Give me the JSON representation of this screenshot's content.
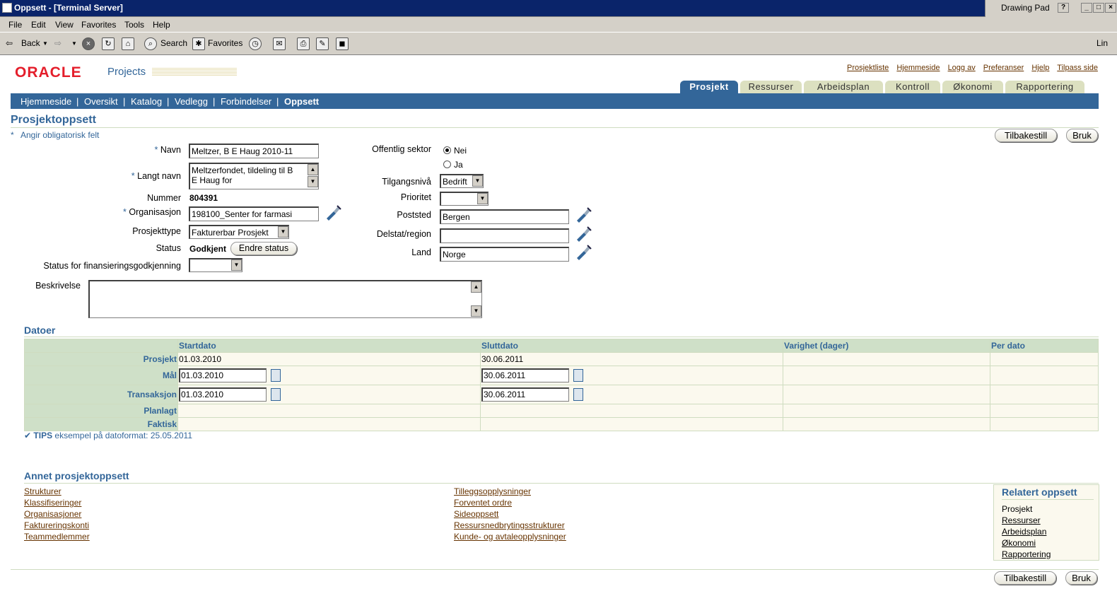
{
  "window": {
    "title": "Oppsett - [Terminal Server]",
    "drawing_pad": "Drawing Pad"
  },
  "menu": [
    "File",
    "Edit",
    "View",
    "Favorites",
    "Tools",
    "Help"
  ],
  "toolbar": {
    "back": "Back",
    "search": "Search",
    "favorites": "Favorites",
    "links": "Lin"
  },
  "brand": {
    "logo": "ORACLE",
    "product": "Projects"
  },
  "global_links": [
    "Prosjektliste",
    "Hjemmeside",
    "Logg av",
    "Preferanser",
    "Hjelp",
    "Tilpass side"
  ],
  "tabs": [
    "Prosjekt",
    "Ressurser",
    "Arbeidsplan",
    "Kontroll",
    "Økonomi",
    "Rapportering"
  ],
  "subnav": [
    "Hjemmeside",
    "Oversikt",
    "Katalog",
    "Vedlegg",
    "Forbindelser",
    "Oppsett"
  ],
  "page": {
    "title": "Prosjektoppsett",
    "required_note": "Angir obligatorisk felt"
  },
  "buttons": {
    "reset": "Tilbakestill",
    "apply": "Bruk",
    "change_status": "Endre status"
  },
  "form": {
    "navn_label": "Navn",
    "navn": "Meltzer, B E Haug 2010-11",
    "langt_navn_label": "Langt navn",
    "langt_navn_line1": "Meltzerfondet, tildeling til B",
    "langt_navn_line2": "E Haug for",
    "nummer_label": "Nummer",
    "nummer": "804391",
    "org_label": "Organisasjon",
    "org": "198100_Senter for farmasi",
    "type_label": "Prosjekttype",
    "type": "Fakturerbar Prosjekt",
    "status_label": "Status",
    "status": "Godkjent",
    "fin_label": "Status for finansieringsgodkjenning",
    "fin": "",
    "beskrivelse_label": "Beskrivelse",
    "beskrivelse": "",
    "offentlig_label": "Offentlig sektor",
    "nei": "Nei",
    "ja": "Ja",
    "tilgang_label": "Tilgangsnivå",
    "tilgang": "Bedrift",
    "prioritet_label": "Prioritet",
    "prioritet": "",
    "poststed_label": "Poststed",
    "poststed": "Bergen",
    "delstat_label": "Delstat/region",
    "delstat": "",
    "land_label": "Land",
    "land": "Norge"
  },
  "dates": {
    "title": "Datoer",
    "headers": [
      "Startdato",
      "Sluttdato",
      "Varighet (dager)",
      "Per dato"
    ],
    "rows": [
      {
        "label": "Prosjekt",
        "start": "01.03.2010",
        "end": "30.06.2011"
      },
      {
        "label": "Mål",
        "start": "01.03.2010",
        "end": "30.06.2011"
      },
      {
        "label": "Transaksjon",
        "start": "01.03.2010",
        "end": "30.06.2011"
      },
      {
        "label": "Planlagt",
        "start": "",
        "end": ""
      },
      {
        "label": "Faktisk",
        "start": "",
        "end": ""
      }
    ],
    "tip_label": "TIPS",
    "tip": "eksempel på datoformat: 25.05.2011"
  },
  "other": {
    "title": "Annet prosjektoppsett",
    "col1": [
      "Strukturer",
      "Klassifiseringer",
      "Organisasjoner",
      "Faktureringskonti",
      "Teammedlemmer"
    ],
    "col2": [
      "Tilleggsopplysninger",
      "Forventet ordre",
      "Sideoppsett",
      "Ressursnedbrytingsstrukturer",
      "Kunde- og avtaleopplysninger"
    ]
  },
  "related": {
    "title": "Relatert oppsett",
    "current": "Prosjekt",
    "links": [
      "Ressurser",
      "Arbeidsplan",
      "Økonomi",
      "Rapportering"
    ]
  }
}
